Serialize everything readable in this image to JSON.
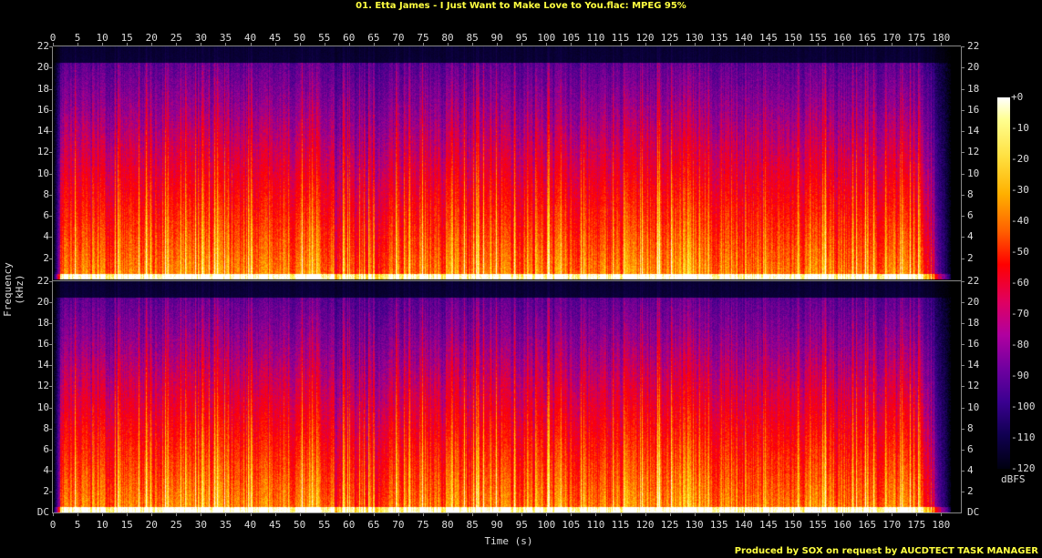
{
  "title": "01. Etta James - I Just Want to Make Love to You.flac: MPEG 95%",
  "credit": "Produced by SOX on request by AUCDTECT TASK MANAGER",
  "chart_data": {
    "type": "heatmap",
    "title": "01. Etta James - I Just Want to Make Love to You.flac: MPEG 95%",
    "xlabel": "Time (s)",
    "ylabel": "Frequency (kHz)",
    "xlim": [
      0,
      184
    ],
    "ylim": [
      0,
      22
    ],
    "channels": 2,
    "x_ticks": [
      0,
      5,
      10,
      15,
      20,
      25,
      30,
      35,
      40,
      45,
      50,
      55,
      60,
      65,
      70,
      75,
      80,
      85,
      90,
      95,
      100,
      105,
      110,
      115,
      120,
      125,
      130,
      135,
      140,
      145,
      150,
      155,
      160,
      165,
      170,
      175,
      180
    ],
    "y_ticks": [
      2,
      4,
      6,
      8,
      10,
      12,
      14,
      16,
      18,
      20,
      22
    ],
    "y_zero_label": "DC",
    "colorbar": {
      "label": "dBFS",
      "range": [
        -120,
        0
      ],
      "ticks": [
        "+0",
        "-10",
        "-20",
        "-30",
        "-40",
        "-50",
        "-60",
        "-70",
        "-80",
        "-90",
        "-100",
        "-110",
        "-120"
      ]
    },
    "audio_end_s": 182,
    "lowpass_cutoff_khz": 20.5
  }
}
